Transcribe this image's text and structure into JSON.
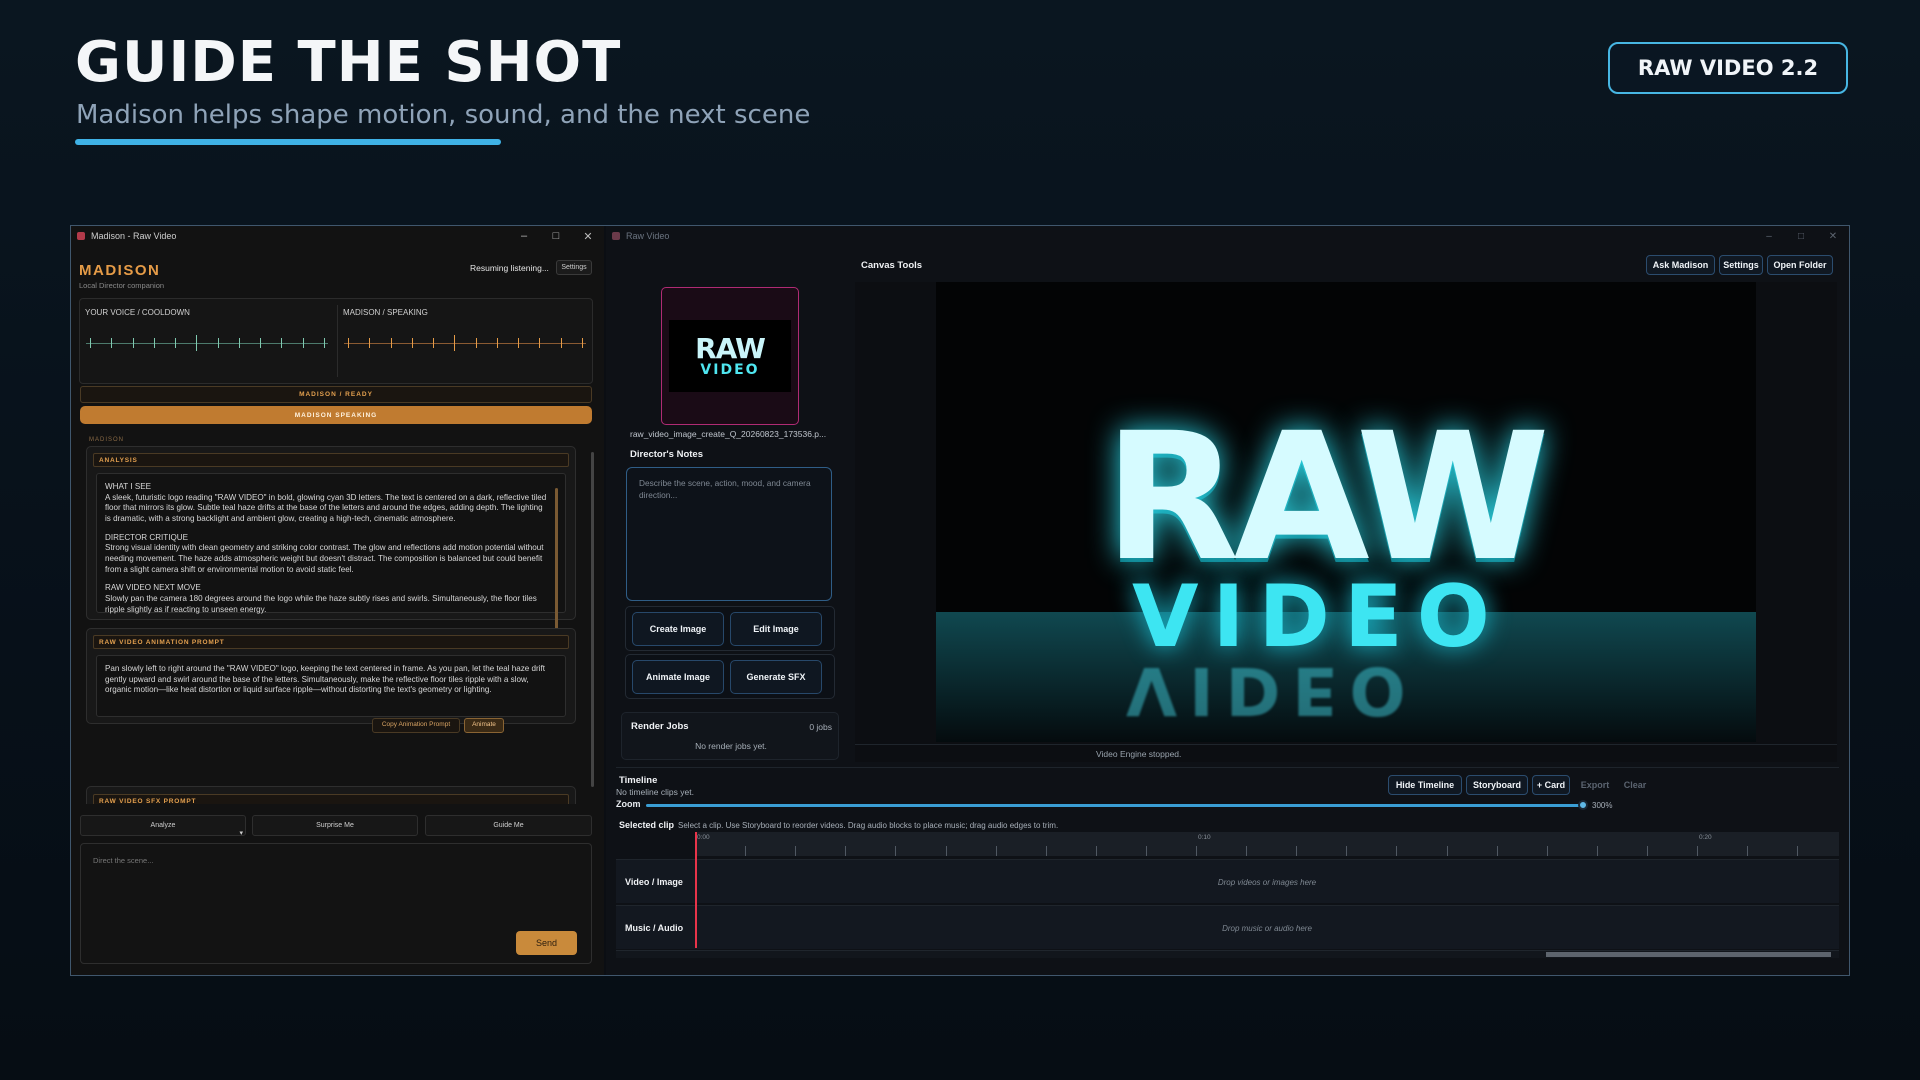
{
  "hero": {
    "title": "GUIDE THE SHOT",
    "subtitle": "Madison helps shape motion, sound, and the next scene",
    "version": "RAW VIDEO 2.2"
  },
  "madison_window": {
    "title": "Madison - Raw Video",
    "brand": "MADISON",
    "tagline": "Local Director companion",
    "status": "Resuming listening...",
    "settings_label": "Settings",
    "voice_label": "YOUR VOICE / COOLDOWN",
    "madison_label": "MADISON / SPEAKING",
    "ready_label": "MADISON / READY",
    "speaking_label": "MADISON SPEAKING",
    "section_label": "MADISON",
    "analysis": {
      "header": "ANALYSIS",
      "paragraphs": [
        "WHAT I SEE\nA sleek, futuristic logo reading \"RAW VIDEO\" in bold, glowing cyan 3D letters. The text is centered on a dark, reflective tiled floor that mirrors its glow. Subtle teal haze drifts at the base of the letters and around the edges, adding depth. The lighting is dramatic, with a strong backlight and ambient glow, creating a high-tech, cinematic atmosphere.",
        "DIRECTOR CRITIQUE\nStrong visual identity with clean geometry and striking color contrast. The glow and reflections add motion potential without needing movement. The haze adds atmospheric weight but doesn't distract. The composition is balanced but could benefit from a slight camera shift or environmental motion to avoid static feel.",
        "RAW VIDEO NEXT MOVE\nSlowly pan the camera 180 degrees around the logo while the haze subtly rises and swirls. Simultaneously, the floor tiles ripple slightly as if reacting to unseen energy."
      ]
    },
    "animation_prompt": {
      "header": "RAW VIDEO ANIMATION PROMPT",
      "text": "Pan slowly left to right around the \"RAW VIDEO\" logo, keeping the text centered in frame. As you pan, let the teal haze drift gently upward and swirl around the base of the letters. Simultaneously, make the reflective floor tiles ripple with a slow, organic motion—like heat distortion or liquid surface ripple—without distorting the text's geometry or lighting.",
      "copy_label": "Copy Animation Prompt",
      "animate_label": "Animate"
    },
    "sfx_prompt": {
      "header": "RAW VIDEO SFX PROMPT"
    },
    "actions": {
      "analyze": "Analyze",
      "surprise": "Surprise Me",
      "guide": "Guide Me"
    },
    "compose_placeholder": "Direct the scene...",
    "send_label": "Send"
  },
  "raw_window": {
    "title": "Raw Video",
    "image_name": "raw_video_image_create_Q_20260823_173536.p...",
    "thumb_raw": "RAW",
    "thumb_video": "VIDEO",
    "notes_label": "Director's Notes",
    "notes_placeholder": "Describe the scene, action, mood, and camera direction...",
    "buttons": {
      "create_image": "Create Image",
      "edit_image": "Edit Image",
      "animate_image": "Animate Image",
      "generate_sfx": "Generate SFX"
    },
    "render_jobs_label": "Render Jobs",
    "render_jobs_count": "0 jobs",
    "render_jobs_empty": "No render jobs yet.",
    "canvas_tools_label": "Canvas Tools",
    "top_buttons": {
      "ask": "Ask Madison",
      "settings": "Settings",
      "open_folder": "Open Folder"
    },
    "preview": {
      "raw": "RAW",
      "video": "VIDEO"
    },
    "engine_status": "Video Engine stopped.",
    "timeline": {
      "title": "Timeline",
      "subtitle": "No timeline clips yet.",
      "hide": "Hide Timeline",
      "storyboard": "Storyboard",
      "card": "+ Card",
      "export": "Export",
      "clear": "Clear",
      "zoom_label": "Zoom",
      "zoom_value": "300%",
      "zoom_fraction": 1.0,
      "selected_label": "Selected clip",
      "selected_hint": "Select a clip. Use Storyboard to reorder videos. Drag audio blocks to place music; drag audio edges to trim.",
      "ruler_labels": [
        "0:00",
        "0:10",
        "0:20"
      ],
      "tracks": [
        {
          "label": "Video / Image",
          "drop": "Drop videos or images here"
        },
        {
          "label": "Music / Audio",
          "drop": "Drop music or audio here"
        }
      ]
    }
  },
  "colors": {
    "accent_blue": "#3fb2e6",
    "madison_orange": "#e59b47",
    "voice_green": "#7fc9b0",
    "playhead_red": "#e8344a",
    "thumb_border": "#b02b74"
  }
}
